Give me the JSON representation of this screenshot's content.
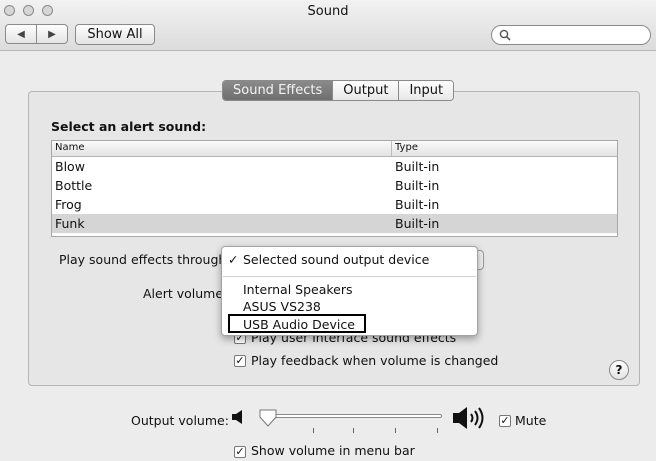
{
  "window": {
    "title": "Sound"
  },
  "toolbar": {
    "back_icon": "◀",
    "forward_icon": "▶",
    "show_all_label": "Show All",
    "search_placeholder": ""
  },
  "tabs": [
    {
      "label": "Sound Effects",
      "active": true
    },
    {
      "label": "Output",
      "active": false
    },
    {
      "label": "Input",
      "active": false
    }
  ],
  "alert": {
    "heading": "Select an alert sound:",
    "columns": [
      "Name",
      "Type"
    ],
    "rows": [
      {
        "name": "Blow",
        "type": "Built-in",
        "selected": false
      },
      {
        "name": "Bottle",
        "type": "Built-in",
        "selected": false
      },
      {
        "name": "Frog",
        "type": "Built-in",
        "selected": false
      },
      {
        "name": "Funk",
        "type": "Built-in",
        "selected": true
      }
    ]
  },
  "play_through": {
    "label": "Play sound effects through",
    "menu": {
      "items": [
        {
          "label": "Selected sound output device",
          "checked": true
        },
        {
          "label": "Internal Speakers",
          "checked": false
        },
        {
          "label": "ASUS VS238",
          "checked": false
        },
        {
          "label": "USB Audio Device",
          "checked": false,
          "highlighted_box": true
        }
      ]
    }
  },
  "alert_volume": {
    "label": "Alert volume"
  },
  "checkboxes": {
    "ui_effects": {
      "label": "Play user interface sound effects",
      "checked": true
    },
    "feedback": {
      "label": "Play feedback when volume is changed",
      "checked": true
    }
  },
  "output": {
    "label": "Output volume:",
    "level": 0.0,
    "mute_label": "Mute",
    "mute_checked": true,
    "show_in_menu_label": "Show volume in menu bar",
    "show_in_menu_checked": true
  },
  "help": {
    "label": "?"
  },
  "colors": {
    "active_tab": "#7d7d7d",
    "window_bg": "#ececec",
    "selected_row": "#d5d5d5"
  }
}
